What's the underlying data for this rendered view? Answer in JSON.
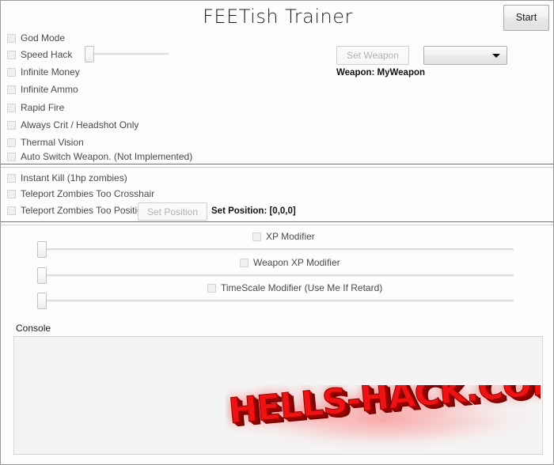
{
  "window": {
    "title": "FEETish Trainer"
  },
  "toolbar": {
    "start_label": "Start"
  },
  "weapon_panel": {
    "set_weapon_label": "Set Weapon",
    "dropdown_value": "",
    "dropdown_arrow_icon": "chevron-down-icon",
    "weapon_status": "Weapon: MyWeapon"
  },
  "general_cheats": [
    {
      "label": "God Mode",
      "checked": false
    },
    {
      "label": "Speed Hack",
      "checked": false
    },
    {
      "label": "Infinite Money",
      "checked": false
    },
    {
      "label": "Infinite Ammo",
      "checked": false
    },
    {
      "label": "Rapid Fire",
      "checked": false
    },
    {
      "label": "Always Crit / Headshot Only",
      "checked": false
    },
    {
      "label": "Thermal Vision",
      "checked": false
    },
    {
      "label": "Auto Switch Weapon. (Not Implemented)",
      "checked": false
    }
  ],
  "zombie_cheats": [
    {
      "label": "Instant Kill (1hp zombies)",
      "checked": false
    },
    {
      "label": "Teleport Zombies Too Crosshair",
      "checked": false
    },
    {
      "label": "Teleport Zombies Too Position",
      "checked": false
    }
  ],
  "position_panel": {
    "set_position_label": "Set Position",
    "position_status": "Set Position: [0,0,0]"
  },
  "modifiers": [
    {
      "label": "XP Modifier",
      "checked": false
    },
    {
      "label": "Weapon XP Modifier",
      "checked": false
    },
    {
      "label": "TimeScale Modifier (Use Me If Retard)",
      "checked": false
    }
  ],
  "console": {
    "label": "Console",
    "text": ""
  },
  "watermark": {
    "text": "HELLS-HACK.COM",
    "color": "#f01212"
  }
}
